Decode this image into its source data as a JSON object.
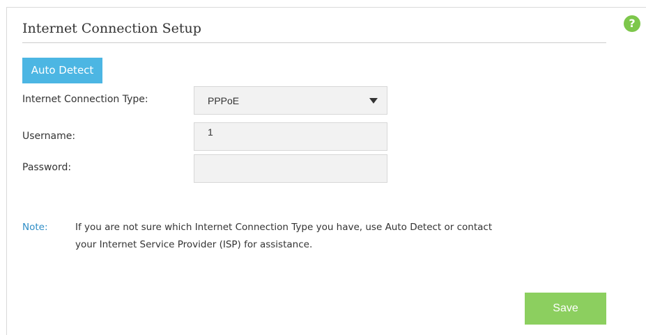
{
  "help": {
    "icon": "help-icon",
    "glyph": "?"
  },
  "section": {
    "title": "Internet Connection Setup"
  },
  "auto_detect": {
    "label": "Auto Detect"
  },
  "form": {
    "connection_type_label": "Internet Connection Type:",
    "connection_type_value": "PPPoE",
    "username_label": "Username:",
    "username_value": "1",
    "password_label": "Password:",
    "password_value": ""
  },
  "note": {
    "label": "Note:",
    "line1": "If you are not sure which Internet Connection Type you have, use Auto Detect or contact",
    "line2": "your Internet Service Provider (ISP) for assistance."
  },
  "actions": {
    "save_label": "Save"
  },
  "colors": {
    "accent_blue": "#4cb6e3",
    "note_blue": "#2e8dc6",
    "save_green": "#8ccf5f",
    "help_green": "#7dc74b",
    "field_bg": "#f2f2f2"
  }
}
